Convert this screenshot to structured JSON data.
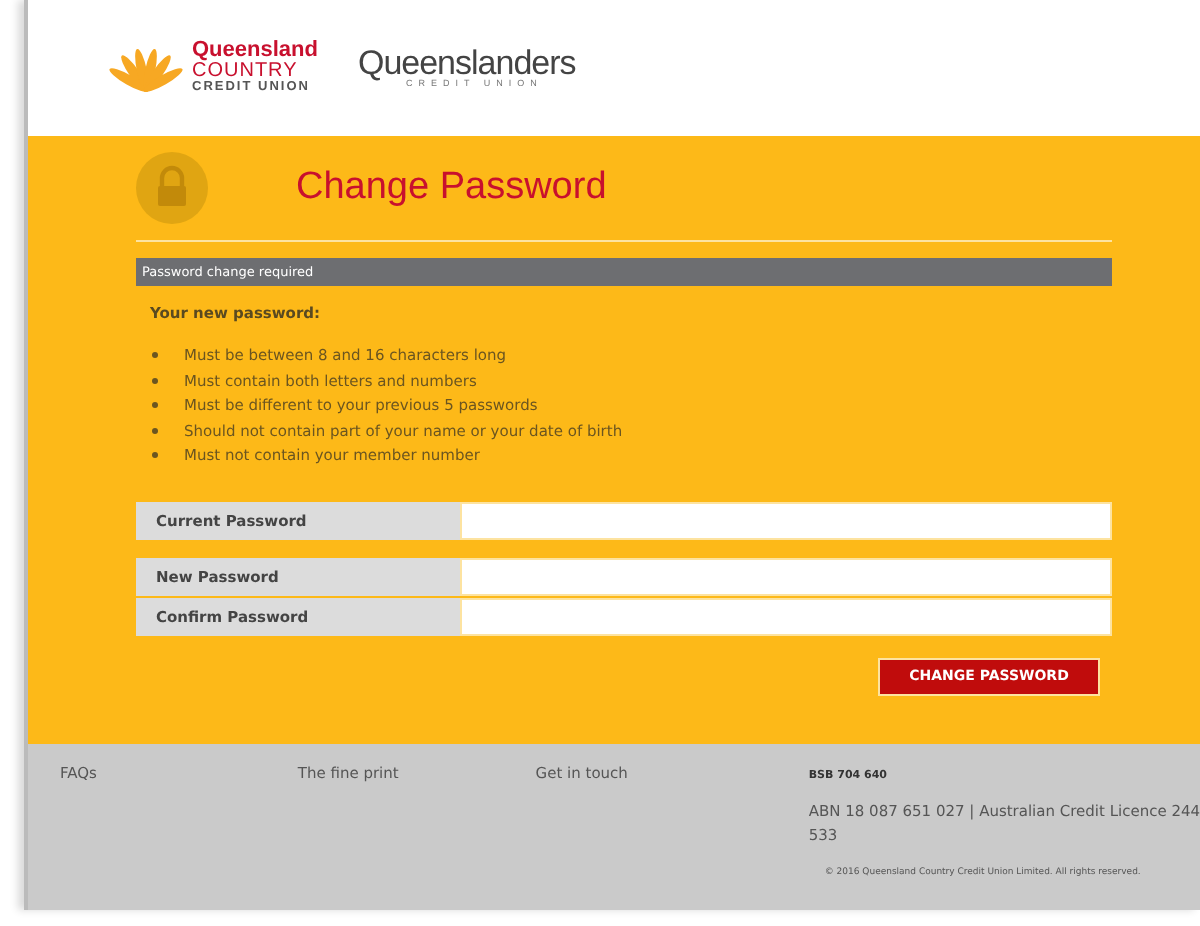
{
  "header": {
    "logo_primary": {
      "line_1": "Queensland",
      "line_2": "COUNTRY",
      "line_3": "CREDIT UNION"
    },
    "logo_secondary": {
      "name": "Queenslanders",
      "tagline": "CREDIT UNION"
    }
  },
  "page_title": "Change Password",
  "notice": "Password change required",
  "requirements": {
    "heading": "Your new password:",
    "items": [
      "Must be between 8 and 16 characters long",
      "Must contain both letters and numbers",
      "Must be different to your previous 5 passwords",
      "Should not contain part of your name or your date of birth",
      "Must not contain your member number"
    ]
  },
  "field_groups": [
    [
      {
        "label": "Current Password"
      }
    ],
    [
      {
        "label": "New Password"
      },
      {
        "label": "Confirm Password"
      }
    ]
  ],
  "submit_button": "CHANGE PASSWORD",
  "footer": {
    "links": [
      "FAQs",
      "The fine print",
      "Get in touch"
    ],
    "bsb": "BSB 704 640",
    "abn_lines": [
      "ABN 18 087 651 027 | Australian Credit Licence 244",
      "533"
    ],
    "copyright": "© 2016 Queensland Country Credit Union Limited. All rights reserved."
  }
}
